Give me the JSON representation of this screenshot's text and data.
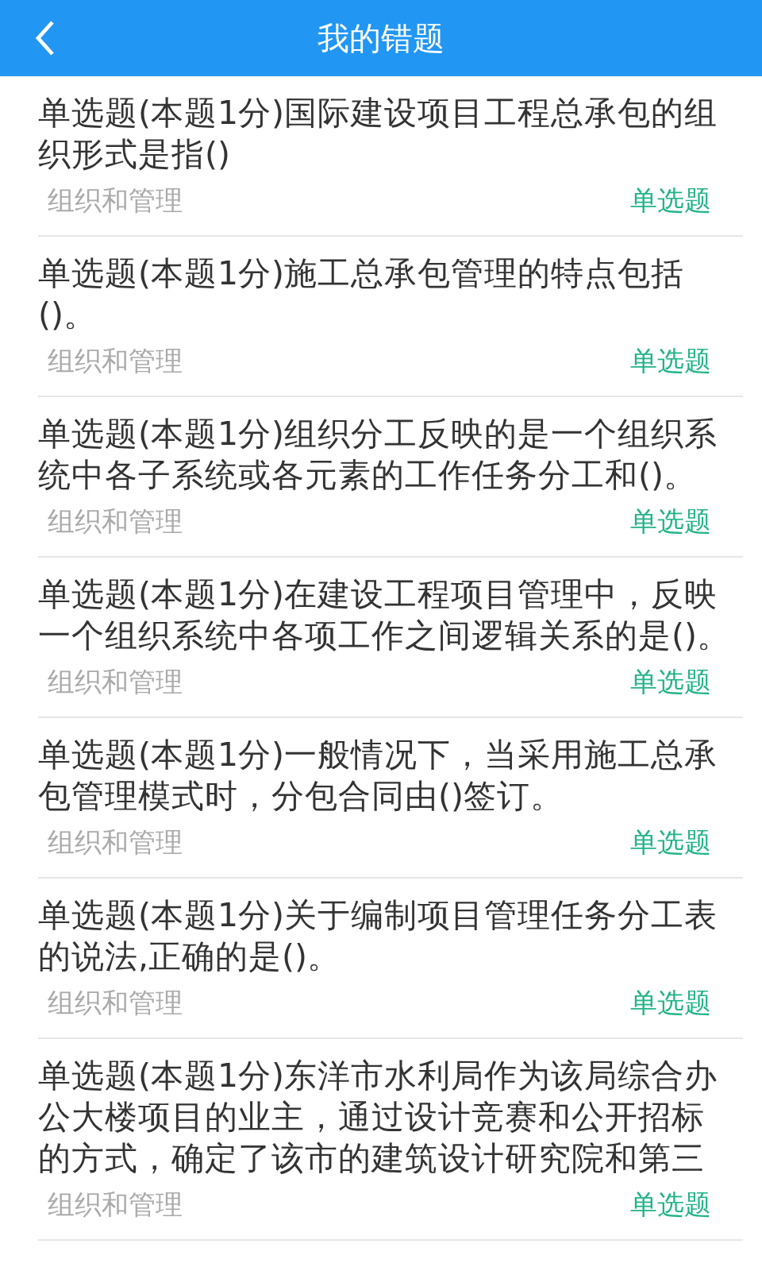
{
  "header": {
    "title": "我的错题"
  },
  "questions": [
    {
      "text": "单选题(本题1分)国际建设项目工程总承包的组织形式是指()",
      "category": "组织和管理",
      "type": "单选题"
    },
    {
      "text": "单选题(本题1分)施工总承包管理的特点包括()。",
      "category": "组织和管理",
      "type": "单选题"
    },
    {
      "text": "单选题(本题1分)组织分工反映的是一个组织系统中各子系统或各元素的工作任务分工和()。",
      "category": "组织和管理",
      "type": "单选题"
    },
    {
      "text": "单选题(本题1分)在建设工程项目管理中，反映一个组织系统中各项工作之间逻辑关系的是()。",
      "category": "组织和管理",
      "type": "单选题"
    },
    {
      "text": "单选题(本题1分)一般情况下，当采用施工总承包管理模式时，分包合同由()签订。",
      "category": "组织和管理",
      "type": "单选题"
    },
    {
      "text": "单选题(本题1分)关于编制项目管理任务分工表的说法,正确的是()。",
      "category": "组织和管理",
      "type": "单选题"
    },
    {
      "text": "单选题(本题1分)东洋市水利局作为该局综合办公大楼项目的业主，通过设计竞赛和公开招标的方式，确定了该市的建筑设计研究院和第三",
      "category": "组织和管理",
      "type": "单选题"
    }
  ]
}
